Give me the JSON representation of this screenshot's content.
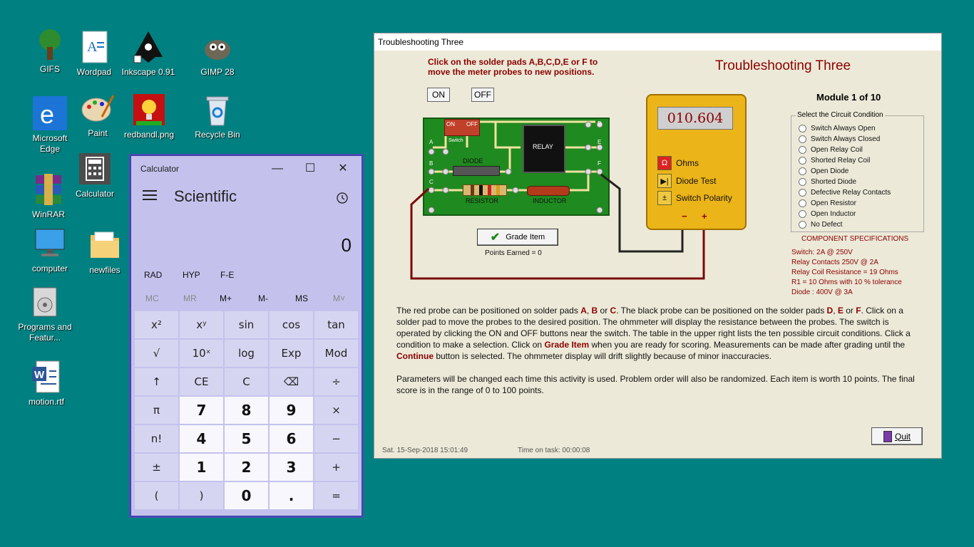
{
  "desktop": {
    "icons": [
      {
        "label": "GIFS"
      },
      {
        "label": "Wordpad"
      },
      {
        "label": "Inkscape 0.91"
      },
      {
        "label": "GIMP 28"
      },
      {
        "label": "Microsoft Edge"
      },
      {
        "label": "Paint"
      },
      {
        "label": "redbandl.png"
      },
      {
        "label": "Recycle Bin"
      },
      {
        "label": "WinRAR"
      },
      {
        "label": "Calculator"
      },
      {
        "label": "computer"
      },
      {
        "label": "newfiles"
      },
      {
        "label": "Programs and Featur..."
      },
      {
        "label": "motion.rtf"
      }
    ]
  },
  "calculator": {
    "title": "Calculator",
    "mode": "Scientific",
    "display": "0",
    "row1": [
      "RAD",
      "HYP",
      "F-E"
    ],
    "memory": [
      "MC",
      "MR",
      "M+",
      "M-",
      "MS",
      "M˅"
    ],
    "keys": [
      "x²",
      "xʸ",
      "sin",
      "cos",
      "tan",
      "√",
      "10ˣ",
      "log",
      "Exp",
      "Mod",
      "↑",
      "CE",
      "C",
      "⌫",
      "÷",
      "π",
      "7",
      "8",
      "9",
      "×",
      "n!",
      "4",
      "5",
      "6",
      "−",
      "±",
      "1",
      "2",
      "3",
      "+",
      "(",
      ")",
      "0",
      ".",
      "="
    ],
    "minimize": "—",
    "maximize": "☐",
    "close": "✕"
  },
  "ts": {
    "window_title": "Troubleshooting Three",
    "title": "Troubleshooting Three",
    "instruction": "Click on the solder pads A,B,C,D,E or F to move the meter probes to new positions.",
    "on_label": "ON",
    "off_label": "OFF",
    "module": "Module 1 of 10",
    "board": {
      "switch_on": "ON",
      "switch_off": "OFF",
      "switch": "Switch",
      "relay": "RELAY",
      "diode": "DIODE",
      "resistor": "RESISTOR",
      "inductor": "INDUCTOR",
      "pads": [
        "A",
        "B",
        "C",
        "D",
        "E",
        "F"
      ]
    },
    "meter": {
      "reading": "010.604",
      "ohms": "Ohms",
      "diode_test": "Diode Test",
      "switch_polarity": "Switch Polarity",
      "minus": "−",
      "plus": "+"
    },
    "grade_label": "Grade Item",
    "points": "Points Earned = 0",
    "cond_legend": "Select the Circuit Condition",
    "conditions": [
      "Switch Always Open",
      "Switch Always Closed",
      "Open Relay Coil",
      "Shorted Relay Coil",
      "Open Diode",
      "Shorted Diode",
      "Defective Relay Contacts",
      "Open Resistor",
      "Open Inductor",
      "No Defect"
    ],
    "specs_title": "COMPONENT SPECIFICATIONS",
    "specs": [
      "Switch: 2A @ 250V",
      "Relay Contacts 250V @ 2A",
      "Relay Coil Resistance = 19 Ohms",
      "R1 = 10 Ohms with 10 % tolerance",
      "Diode : 400V @ 3A"
    ],
    "desc1": {
      "t1": "The red probe can be positioned on solder pads ",
      "a": "A",
      "c1": ", ",
      "b": "B",
      "or1": " or ",
      "c": "C",
      "t2": ". The black probe can be positioned on the solder pads ",
      "d": "D",
      "c2": ", ",
      "e": "E",
      "or2": " or ",
      "f": "F",
      "t3": ". Click on a solder pad to move the probes to the desired position.  The ohmmeter will display the resistance between the probes. The switch is operated by clicking the ON and OFF buttons near the switch. The table in the upper right lists the ten possible circuit conditions. Click a condition to make a selection.  Click on ",
      "grade": "Grade Item",
      "t4": " when you are ready for scoring. Measurements can be made after grading until the ",
      "cont": "Continue",
      "t5": " button is selected. The ohmmeter display will drift slightly because of minor inaccuracies."
    },
    "desc2": "Parameters will be changed each time this activity is used. Problem order will also be randomized. Each item is worth 10 points. The final score is in the range of 0 to 100 points.",
    "quit": "Quit",
    "date": "Sat.  15-Sep-2018   15:01:49",
    "time_on_task": "Time on task:  00:00:08"
  },
  "colors": {
    "desktop": "#008080",
    "calc_bg": "#c4c2ec",
    "dark_red": "#8b0000",
    "board_green": "#1f8a1f",
    "meter_yellow": "#ebb418"
  }
}
